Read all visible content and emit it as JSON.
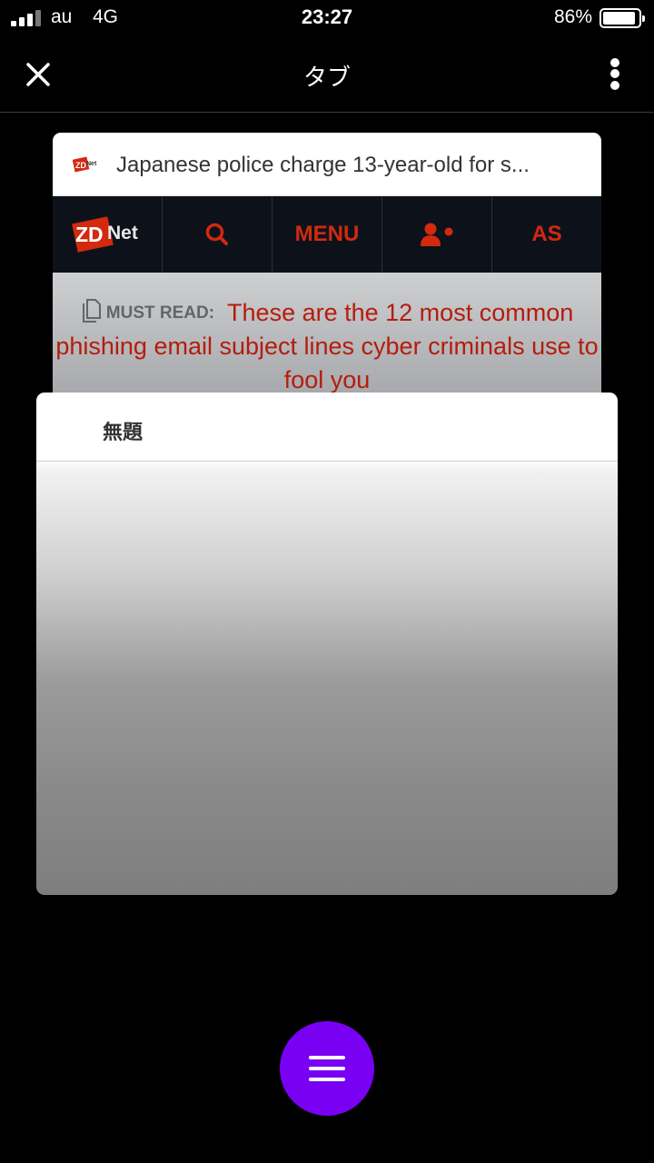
{
  "status_bar": {
    "carrier": "au",
    "network": "4G",
    "time": "23:27",
    "battery_percent": "86%",
    "battery_level": 0.86
  },
  "nav": {
    "title": "タブ",
    "close_icon": "close-icon",
    "more_icon": "more-vertical-icon"
  },
  "tabs": [
    {
      "title": "Japanese police charge 13-year-old for s...",
      "site_nav": {
        "logo_text": "ZDNet",
        "menu_label": "MENU",
        "edition_label": "AS"
      },
      "banner": {
        "label": "MUST READ:",
        "headline": "These are the 12 most common phishing email subject lines cyber criminals use to fool you"
      }
    },
    {
      "title": "無題"
    }
  ],
  "fab": {
    "icon": "menu-icon"
  },
  "colors": {
    "fab": "#7a00f4",
    "zdnet_red": "#d2290f",
    "headline_red": "#b51c0c",
    "site_nav_bg": "#0d121a"
  }
}
